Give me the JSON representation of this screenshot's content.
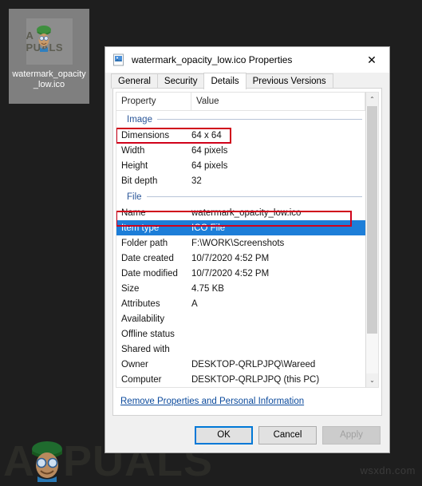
{
  "desktop": {
    "icon": {
      "label": "watermark_opacity_low.ico",
      "art_text": "A  PUALS",
      "icon_name": "ico-file-thumbnail"
    }
  },
  "watermark": {
    "brand_a": "A",
    "brand_rest": "PUALS",
    "site": "wsxdn.com"
  },
  "dialog": {
    "title": "watermark_opacity_low.ico Properties",
    "title_icon": "ico-file-icon",
    "close_label": "✕",
    "tabs": [
      {
        "label": "General",
        "active": false
      },
      {
        "label": "Security",
        "active": false
      },
      {
        "label": "Details",
        "active": true
      },
      {
        "label": "Previous Versions",
        "active": false
      }
    ],
    "columns": {
      "property": "Property",
      "value": "Value"
    },
    "sections": [
      {
        "name": "Image",
        "rows": [
          {
            "name": "Dimensions",
            "value": "64 x 64",
            "selected": false,
            "highlighted": true
          },
          {
            "name": "Width",
            "value": "64 pixels",
            "selected": false,
            "highlighted": false
          },
          {
            "name": "Height",
            "value": "64 pixels",
            "selected": false,
            "highlighted": false
          },
          {
            "name": "Bit depth",
            "value": "32",
            "selected": false,
            "highlighted": false
          }
        ]
      },
      {
        "name": "File",
        "rows": [
          {
            "name": "Name",
            "value": "watermark_opacity_low.ico",
            "selected": false,
            "highlighted": false
          },
          {
            "name": "Item type",
            "value": "ICO File",
            "selected": true,
            "highlighted": true
          },
          {
            "name": "Folder path",
            "value": "F:\\WORK\\Screenshots",
            "selected": false,
            "highlighted": false
          },
          {
            "name": "Date created",
            "value": "10/7/2020 4:52 PM",
            "selected": false,
            "highlighted": false
          },
          {
            "name": "Date modified",
            "value": "10/7/2020 4:52 PM",
            "selected": false,
            "highlighted": false
          },
          {
            "name": "Size",
            "value": "4.75 KB",
            "selected": false,
            "highlighted": false
          },
          {
            "name": "Attributes",
            "value": "A",
            "selected": false,
            "highlighted": false
          },
          {
            "name": "Availability",
            "value": "",
            "selected": false,
            "highlighted": false
          },
          {
            "name": "Offline status",
            "value": "",
            "selected": false,
            "highlighted": false
          },
          {
            "name": "Shared with",
            "value": "",
            "selected": false,
            "highlighted": false
          },
          {
            "name": "Owner",
            "value": "DESKTOP-QRLPJPQ\\Wareed",
            "selected": false,
            "highlighted": false
          },
          {
            "name": "Computer",
            "value": "DESKTOP-QRLPJPQ (this PC)",
            "selected": false,
            "highlighted": false
          }
        ]
      }
    ],
    "scrollbar": {
      "up_glyph": "⌃",
      "down_glyph": "⌄",
      "thumb_percent": 85
    },
    "remove_properties_link": "Remove Properties and Personal Information",
    "buttons": [
      {
        "label": "OK",
        "style": "default"
      },
      {
        "label": "Cancel",
        "style": "normal"
      },
      {
        "label": "Apply",
        "style": "disabled"
      }
    ]
  },
  "colors": {
    "accent": "#0078d7",
    "selection": "#1d7ed8",
    "highlight_border": "#d0021b",
    "section_header": "#2a5699",
    "link": "#0b4a9c",
    "desktop_bg": "#1e1e1e"
  }
}
